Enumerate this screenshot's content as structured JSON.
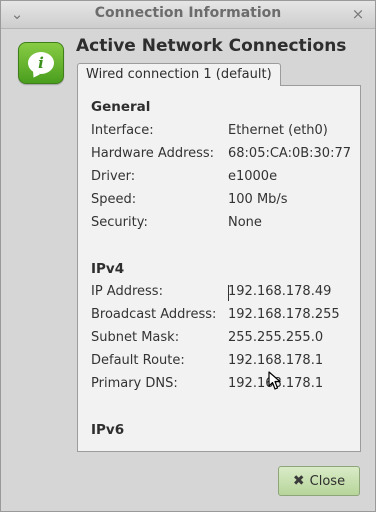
{
  "window": {
    "title": "Connection Information",
    "menu_icon": "⌄",
    "close_icon": "×"
  },
  "heading": "Active Network Connections",
  "tab": {
    "label": "Wired connection 1 (default)"
  },
  "sections": {
    "general": {
      "title": "General",
      "rows": [
        {
          "label": "Interface:",
          "value": "Ethernet (eth0)"
        },
        {
          "label": "Hardware Address:",
          "value": "68:05:CA:0B:30:77"
        },
        {
          "label": "Driver:",
          "value": "e1000e"
        },
        {
          "label": "Speed:",
          "value": "100 Mb/s"
        },
        {
          "label": "Security:",
          "value": "None"
        }
      ]
    },
    "ipv4": {
      "title": "IPv4",
      "rows": [
        {
          "label": "IP Address:",
          "value": "192.168.178.49"
        },
        {
          "label": "Broadcast Address:",
          "value": "192.168.178.255"
        },
        {
          "label": "Subnet Mask:",
          "value": "255.255.255.0"
        },
        {
          "label": "Default Route:",
          "value": "192.168.178.1"
        },
        {
          "label": "Primary DNS:",
          "value": "192.168.178.1"
        }
      ]
    },
    "ipv6": {
      "title": "IPv6"
    }
  },
  "buttons": {
    "close_label": "Close",
    "close_icon": "✖"
  },
  "colors": {
    "accent_green": "#6bb536",
    "button_green": "#c8e2ae"
  }
}
